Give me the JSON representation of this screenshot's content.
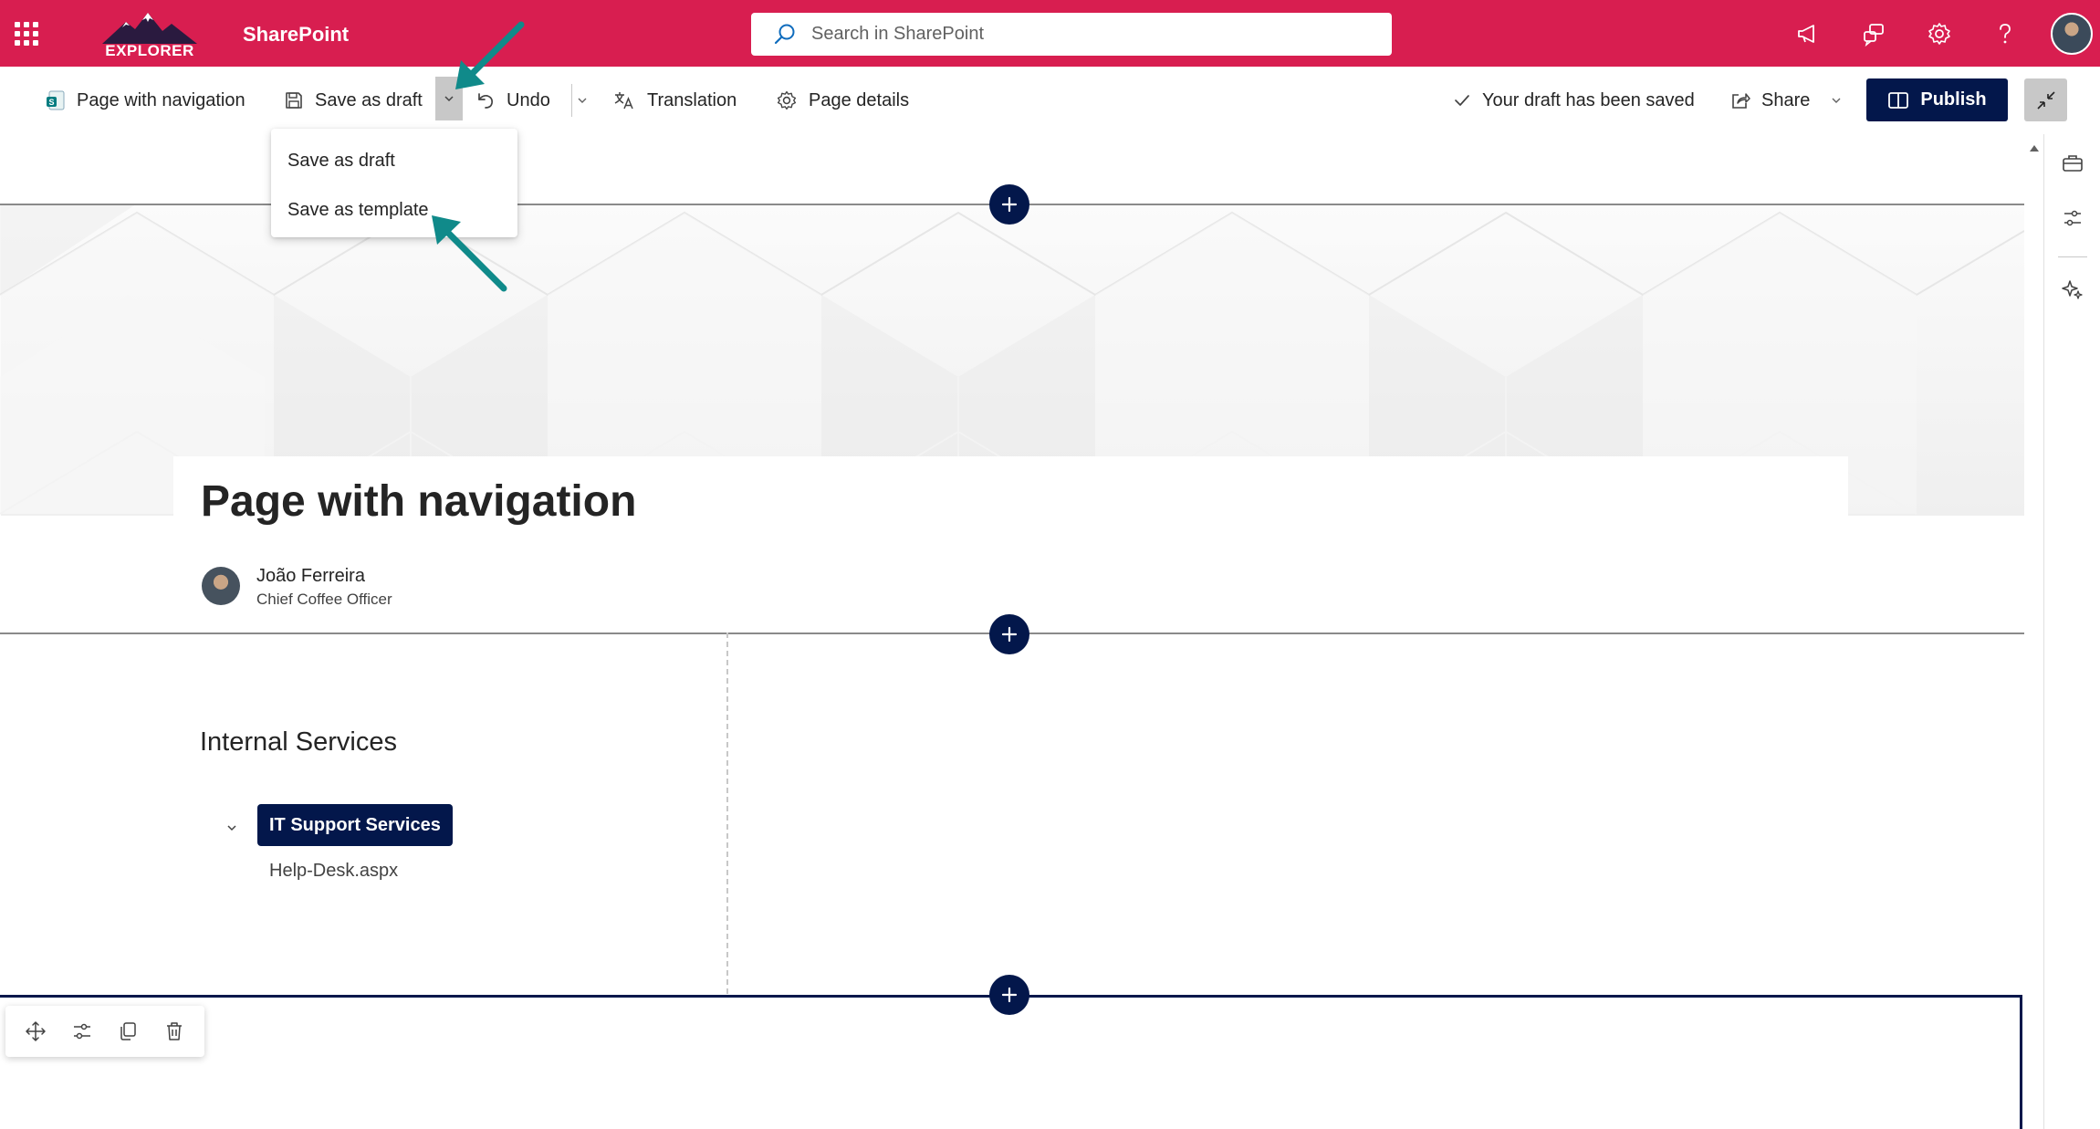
{
  "suite_bar": {
    "brand_color": "#d81e50",
    "logo_text": "EXPLORER",
    "app_name": "SharePoint",
    "search_placeholder": "Search in SharePoint",
    "icons": [
      "app-launcher-icon",
      "megaphone-icon",
      "chat-help-icon",
      "gear-icon",
      "question-icon",
      "user-avatar"
    ]
  },
  "command_bar": {
    "page_name": "Page with navigation",
    "save_draft": "Save as draft",
    "undo": "Undo",
    "translation": "Translation",
    "page_details": "Page details",
    "status": "Your draft has been saved",
    "share": "Share",
    "publish": "Publish",
    "accent_color": "#03174b"
  },
  "save_menu": {
    "items": [
      "Save as draft",
      "Save as template"
    ]
  },
  "page": {
    "title": "Page with navigation",
    "author": {
      "name": "João Ferreira",
      "role": "Chief Coffee Officer"
    },
    "navigation": {
      "heading": "Internal Services",
      "group": "IT Support Services",
      "child": "Help-Desk.aspx"
    }
  },
  "section_toolbar": {
    "icons": [
      "move-icon",
      "edit-section-icon",
      "duplicate-icon",
      "delete-icon"
    ]
  },
  "right_rail": {
    "icons": [
      "toolbox-icon",
      "properties-icon",
      "designer-icon"
    ]
  }
}
